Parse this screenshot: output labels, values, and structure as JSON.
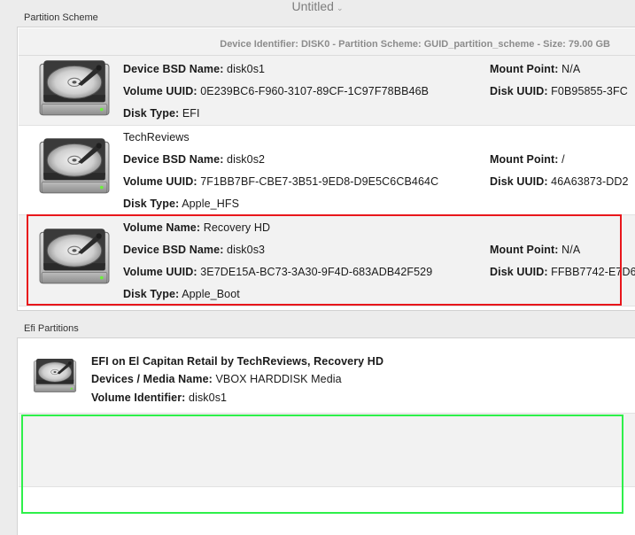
{
  "window": {
    "title": "Untitled"
  },
  "partition_section": {
    "label": "Partition Scheme",
    "header": "Device Identifier: DISK0 - Partition Scheme: GUID_partition_scheme - Size: 79.00 GB",
    "partitions": [
      {
        "bsd_label": "Device BSD Name:",
        "bsd": "disk0s1",
        "uuid_label": "Volume UUID:",
        "uuid": "0E239BC6-F960-3107-89CF-1C97F78BB46B",
        "type_label": "Disk Type:",
        "type": "EFI",
        "mount_label": "Mount Point:",
        "mount": "N/A",
        "disk_uuid_label": "Disk UUID:",
        "disk_uuid": "F0B95855-3FC"
      },
      {
        "volume_cont": "TechReviews",
        "bsd_label": "Device BSD Name:",
        "bsd": "disk0s2",
        "uuid_label": "Volume UUID:",
        "uuid": "7F1BB7BF-CBE7-3B51-9ED8-D9E5C6CB464C",
        "type_label": "Disk Type:",
        "type": "Apple_HFS",
        "mount_label": "Mount Point:",
        "mount": "/",
        "disk_uuid_label": "Disk UUID:",
        "disk_uuid": "46A63873-DD2"
      },
      {
        "volume_label": "Volume Name:",
        "volume": "Recovery HD",
        "bsd_label": "Device BSD Name:",
        "bsd": "disk0s3",
        "uuid_label": "Volume UUID:",
        "uuid": "3E7DE15A-BC73-3A30-9F4D-683ADB42F529",
        "type_label": "Disk Type:",
        "type": "Apple_Boot",
        "mount_label": "Mount Point:",
        "mount": "N/A",
        "disk_uuid_label": "Disk UUID:",
        "disk_uuid": "FFBB7742-E7D6"
      }
    ]
  },
  "efi_section": {
    "label": "Efi Partitions",
    "item": {
      "title": "EFI on El Capitan Retail by TechReviews, Recovery HD",
      "media_label": "Devices / Media Name:",
      "media": "VBOX HARDDISK Media",
      "vid_label": "Volume Identifier:",
      "vid": "disk0s1"
    }
  },
  "colors": {
    "highlight_red": "#e8161b",
    "highlight_green": "#2ef04a"
  }
}
